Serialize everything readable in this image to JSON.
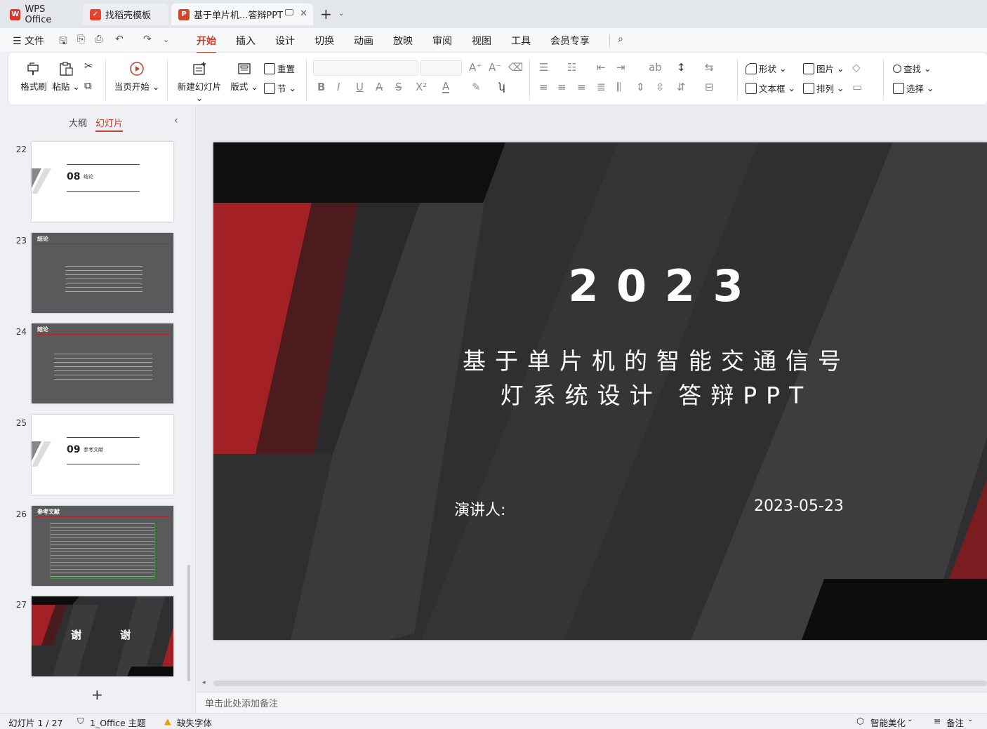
{
  "tabs": [
    {
      "label": "WPS Office",
      "icon": "wps-logo-icon",
      "color": "#e0312a"
    },
    {
      "label": "找稻壳模板",
      "icon": "docer-logo-icon",
      "color": "#e5422f"
    },
    {
      "label": "基于单片机...答辩PPT",
      "icon": "ppt-file-icon",
      "color": "#d24726"
    }
  ],
  "menubar": {
    "file": "文件",
    "items": [
      "开始",
      "插入",
      "设计",
      "切换",
      "动画",
      "放映",
      "审阅",
      "视图",
      "工具",
      "会员专享"
    ],
    "active": "开始"
  },
  "ribbon": {
    "format_painter": "格式刷",
    "paste": "粘贴",
    "from_current": "当页开始",
    "new_slide": "新建幻灯片",
    "layout": "版式",
    "reset": "重置",
    "section": "节",
    "shape": "形状",
    "picture": "图片",
    "textbox": "文本框",
    "arrange": "排列",
    "find": "查找",
    "select": "选择"
  },
  "left_panel": {
    "outline_tab": "大纲",
    "slides_tab": "幻灯片",
    "thumbs": [
      {
        "num": "22",
        "kind": "section",
        "section_num": "08",
        "section_title": "结论"
      },
      {
        "num": "23",
        "kind": "text",
        "title": "结论"
      },
      {
        "num": "24",
        "kind": "text",
        "title": "结论"
      },
      {
        "num": "25",
        "kind": "section",
        "section_num": "09",
        "section_title": "参考文献"
      },
      {
        "num": "26",
        "kind": "refs",
        "title": "参考文献"
      },
      {
        "num": "27",
        "kind": "end",
        "left": "谢",
        "right": "谢"
      }
    ]
  },
  "slide": {
    "year": "2 0 2 3",
    "title_line1": "基于单片机的智能交通信号",
    "title_line2": "灯系统设计 答辩PPT",
    "presenter": "演讲人:",
    "date": "2023-05-23"
  },
  "notes_placeholder": "单击此处添加备注",
  "status": {
    "slide_count": "幻灯片 1 / 27",
    "theme": "1_Office 主题",
    "missing_font": "缺失字体",
    "beautify": "智能美化",
    "notes": "备注"
  }
}
